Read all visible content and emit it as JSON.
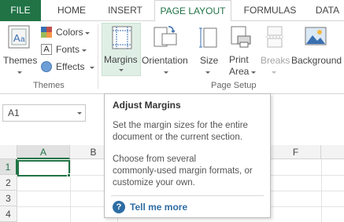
{
  "tabs": {
    "file": "FILE",
    "home": "HOME",
    "insert": "INSERT",
    "page_layout": "PAGE LAYOUT",
    "formulas": "FORMULAS",
    "data": "DATA"
  },
  "ribbon": {
    "themes_group": {
      "themes_label": "Themes",
      "colors_label": "Colors",
      "fonts_label": "Fonts",
      "effects_label": "Effects",
      "group_label": "Themes",
      "fonts_icon_text": "A"
    },
    "page_setup_group": {
      "margins_label": "Margins",
      "orientation_label": "Orientation",
      "size_label": "Size",
      "print_area_line1": "Print",
      "print_area_line2": "Area",
      "breaks_label": "Breaks",
      "background_label": "Background",
      "group_label": "Page Setup"
    }
  },
  "name_box": {
    "value": "A1"
  },
  "grid": {
    "columns": [
      "A",
      "B",
      "F"
    ],
    "rows": [
      "1",
      "2",
      "3",
      "4"
    ],
    "selected_cell": "A1"
  },
  "tooltip": {
    "title": "Adjust Margins",
    "paragraph1": [
      "Set the margin sizes for the entire",
      "document or the current section."
    ],
    "paragraph2": [
      "Choose from several",
      "commonly-used margin formats, or",
      "customize your own."
    ],
    "help_icon_glyph": "?",
    "help_link": "Tell me more"
  },
  "colors": {
    "accent": "#217346",
    "margins_highlight": "#e0efe6",
    "help_blue": "#2e6da4"
  }
}
